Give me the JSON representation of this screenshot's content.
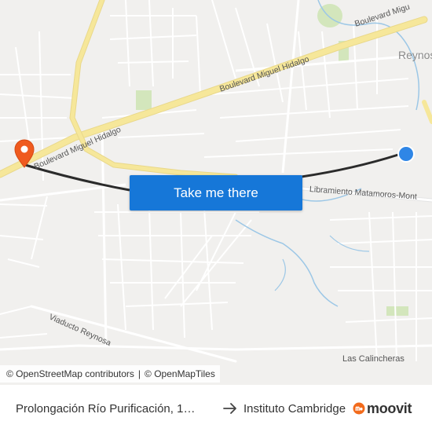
{
  "map": {
    "labels": {
      "city": "Reynosa",
      "blvd_hidalgo_left": "Boulevard Miguel Hidalgo",
      "blvd_hidalgo_mid": "Boulevard Miguel Hidalgo",
      "blvd_top_right": "Boulevard Migu",
      "libramiento": "Libramiento Matamoros-Mont",
      "viaducto": "Viaducto Reynosa",
      "calincheras": "Las Calincheras"
    },
    "colors": {
      "land": "#f1f0ee",
      "major_road": "#f6e79a",
      "minor_road": "#ffffff",
      "park": "#d3e6bc",
      "river": "#9cc7e6",
      "route": "#2b2b2b",
      "origin": "#2f86e6",
      "destination": "#ef5a1e"
    },
    "origin_marker_icon": "origin-dot-icon",
    "destination_marker_icon": "destination-pin-icon"
  },
  "cta": {
    "label": "Take me there"
  },
  "attribution": {
    "osm": "© OpenStreetMap contributors",
    "sep": "|",
    "omt": "© OpenMapTiles"
  },
  "footer": {
    "from": "Prolongación Río Purificación, 1…",
    "arrow_icon": "arrow-right-icon",
    "to": "Instituto Cambridge",
    "brand": "moovit",
    "brand_icon": "moovit-logo-icon",
    "brand_color": "#f26a1b"
  }
}
